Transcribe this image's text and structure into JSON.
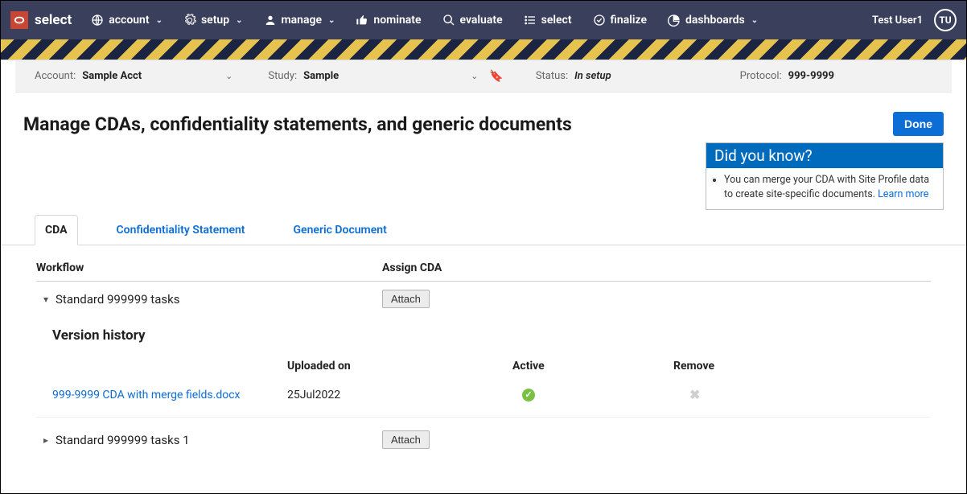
{
  "brand": {
    "text": "select"
  },
  "nav": {
    "items": [
      {
        "label": "account",
        "icon": "globe",
        "caret": true
      },
      {
        "label": "setup",
        "icon": "gear",
        "caret": true
      },
      {
        "label": "manage",
        "icon": "person",
        "caret": true
      },
      {
        "label": "nominate",
        "icon": "thumb",
        "caret": false
      },
      {
        "label": "evaluate",
        "icon": "search",
        "caret": false
      },
      {
        "label": "select",
        "icon": "list",
        "caret": false
      },
      {
        "label": "finalize",
        "icon": "check",
        "caret": false
      },
      {
        "label": "dashboards",
        "icon": "pie",
        "caret": true
      }
    ]
  },
  "user": {
    "name": "Test User1",
    "initials": "TU"
  },
  "context": {
    "account_label": "Account:",
    "account_value": "Sample Acct",
    "study_label": "Study:",
    "study_value": "Sample",
    "status_label": "Status:",
    "status_value": "In setup",
    "protocol_label": "Protocol:",
    "protocol_value": "999-9999"
  },
  "page": {
    "title": "Manage CDAs, confidentiality statements, and generic documents",
    "done": "Done"
  },
  "dyk": {
    "title": "Did you know?",
    "text": "You can merge your CDA with Site Profile data to create site-specific documents. ",
    "link": "Learn more"
  },
  "tabs": [
    {
      "label": "CDA",
      "active": true
    },
    {
      "label": "Confidentiality Statement",
      "active": false
    },
    {
      "label": "Generic Document",
      "active": false
    }
  ],
  "workflow": {
    "col1": "Workflow",
    "col2": "Assign CDA",
    "attach": "Attach",
    "rows": [
      {
        "name": "Standard 999999 tasks",
        "expanded": true
      },
      {
        "name": "Standard 999999 tasks 1",
        "expanded": false
      }
    ],
    "version_title": "Version history",
    "vh_headers": {
      "uploaded": "Uploaded on",
      "active": "Active",
      "remove": "Remove"
    },
    "versions": [
      {
        "file": "999-9999 CDA with merge fields.docx",
        "uploaded": "25Jul2022",
        "active": true
      }
    ]
  }
}
